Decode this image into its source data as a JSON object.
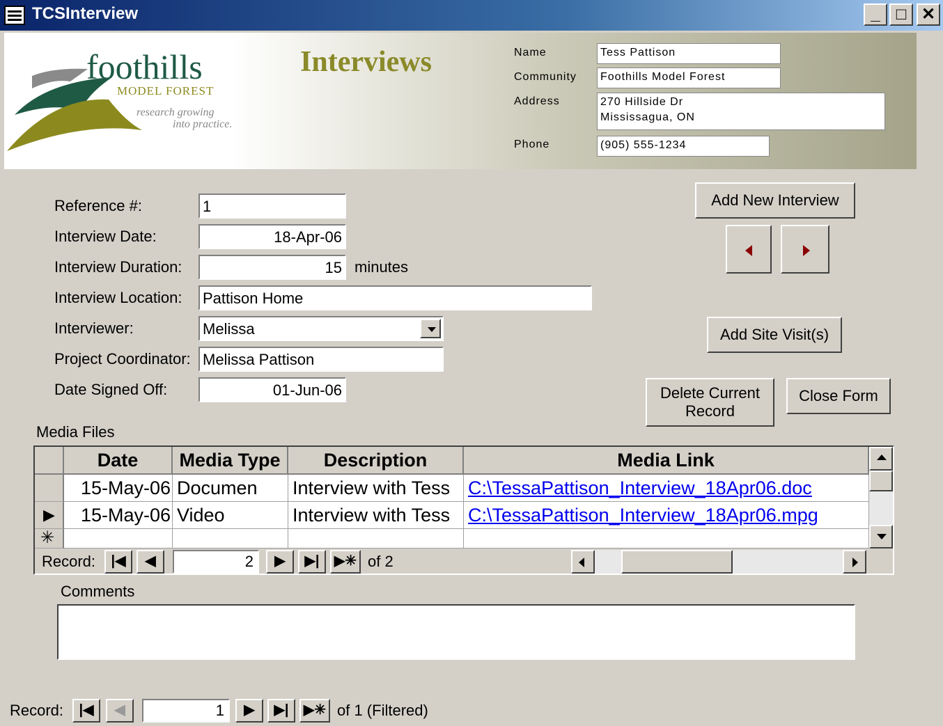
{
  "window": {
    "title": "TCSInterview"
  },
  "header": {
    "logo_main": "foothills",
    "logo_sub": "MODEL FOREST",
    "logo_tag_line1": "research growing",
    "logo_tag_line2": "into practice.",
    "title": "Interviews",
    "name_label": "Name",
    "name_value": "Tess Pattison",
    "community_label": "Community",
    "community_value": "Foothills Model Forest",
    "address_label": "Address",
    "address_value": "270 Hillside Dr\nMississagua, ON",
    "phone_label": "Phone",
    "phone_value": "(905) 555-1234"
  },
  "form": {
    "reference_label": "Reference #:",
    "reference_value": "1",
    "date_label": "Interview Date:",
    "date_value": "18-Apr-06",
    "duration_label": "Interview Duration:",
    "duration_value": "15",
    "duration_unit": "minutes",
    "location_label": "Interview Location:",
    "location_value": "Pattison Home",
    "interviewer_label": "Interviewer:",
    "interviewer_value": "Melissa",
    "coordinator_label": "Project Coordinator:",
    "coordinator_value": "Melissa Pattison",
    "signed_label": "Date Signed Off:",
    "signed_value": "01-Jun-06"
  },
  "buttons": {
    "add_interview": "Add New Interview",
    "add_site_visit": "Add Site Visit(s)",
    "delete_record": "Delete Current Record",
    "close_form": "Close Form"
  },
  "media": {
    "section_label": "Media Files",
    "columns": [
      "Date",
      "Media Type",
      "Description",
      "Media Link"
    ],
    "rows": [
      {
        "date": "15-May-06",
        "type": "Documen",
        "description": "Interview with Tess",
        "link": "C:\\TessaPattison_Interview_18Apr06.doc"
      },
      {
        "date": "15-May-06",
        "type": "Video",
        "description": "Interview with Tess",
        "link": "C:\\TessaPattison_Interview_18Apr06.mpg"
      }
    ],
    "nav_label": "Record:",
    "nav_current": "2",
    "nav_of": "of  2"
  },
  "comments": {
    "label": "Comments",
    "value": ""
  },
  "footer_nav": {
    "label": "Record:",
    "current": "1",
    "of": "of  1 (Filtered)"
  },
  "colors": {
    "title_bar": "#0a246a",
    "banner_title": "#8b8a2a",
    "logo_green": "#1f5a45",
    "nav_arrow": "#8b0000",
    "link": "#0000ee"
  }
}
